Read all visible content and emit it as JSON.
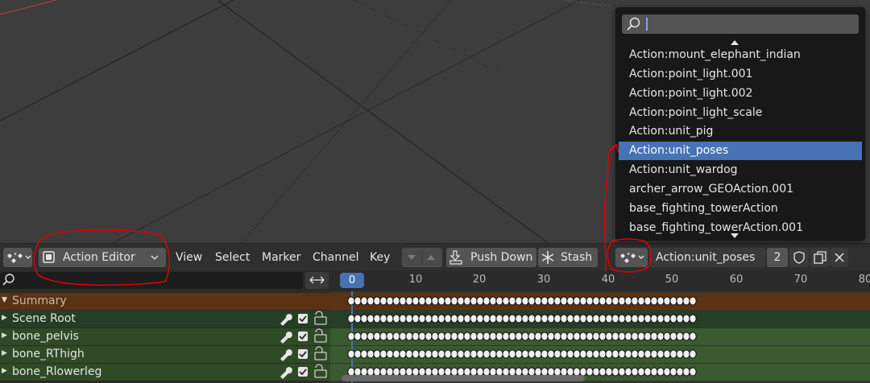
{
  "header": {
    "editor_type": "Action Editor",
    "menus": [
      "View",
      "Select",
      "Marker",
      "Channel",
      "Key"
    ],
    "push_down_label": "Push Down",
    "stash_label": "Stash",
    "action_name": "Action:unit_poses",
    "user_count": "2"
  },
  "dropdown": {
    "search_value": "",
    "items": [
      "Action:mount_elephant_indian",
      "Action:point_light.001",
      "Action:point_light.002",
      "Action:point_light_scale",
      "Action:unit_pig",
      "Action:unit_poses",
      "Action:unit_wardog",
      "archer_arrow_GEOAction.001",
      "base_fighting_towerAction",
      "base_fighting_towerAction.001"
    ],
    "selected": "Action:unit_poses"
  },
  "channels": [
    {
      "label": "Summary",
      "kind": "summary"
    },
    {
      "label": "Scene Root",
      "kind": "object"
    },
    {
      "label": "bone_pelvis",
      "kind": "group"
    },
    {
      "label": "bone_RThigh",
      "kind": "group"
    },
    {
      "label": "bone_Rlowerleg",
      "kind": "group"
    }
  ],
  "timeline": {
    "current_frame": "0",
    "ticks": [
      "10",
      "20",
      "30",
      "40",
      "50",
      "60",
      "70",
      "80"
    ]
  },
  "colors": {
    "summary_row": "#5a3314",
    "group_row": "#2f4a25",
    "selected_item": "#4772b3",
    "annotation_red": "#e00000",
    "current_frame": "#4772b3"
  }
}
